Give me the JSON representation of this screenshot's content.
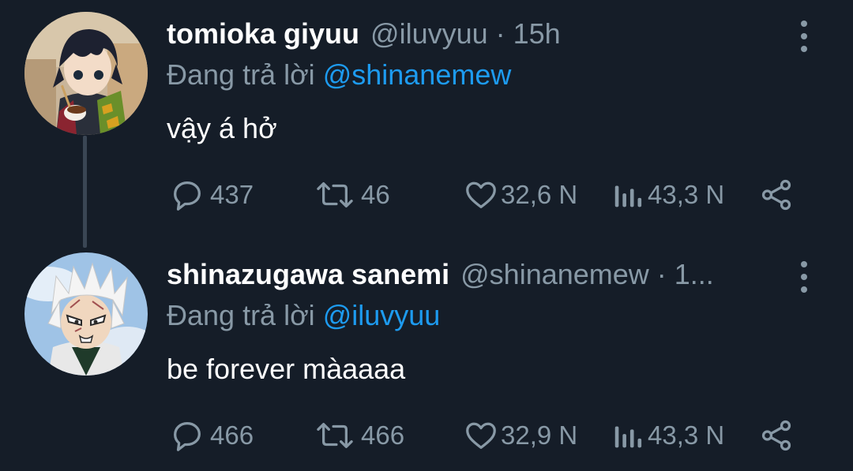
{
  "tweets": [
    {
      "name": "tomioka giyuu",
      "handle_time": "@iluvyuu · 15h",
      "reply_prefix": "Đang trả lời",
      "reply_to": "@shinanemew",
      "text": "vậy á hở",
      "stats": {
        "replies": "437",
        "retweets": "46",
        "likes": "32,6 N",
        "views": "43,3 N"
      },
      "avatar_icon": "avatar-tomioka-giyuu"
    },
    {
      "name": "shinazugawa sanemi",
      "handle_time": "@shinanemew · 1...",
      "reply_prefix": "Đang trả lời",
      "reply_to": "@iluvyuu",
      "text": "be forever màaaaa",
      "stats": {
        "replies": "466",
        "retweets": "466",
        "likes": "32,9 N",
        "views": "43,3 N"
      },
      "avatar_icon": "avatar-shinazugawa-sanemi"
    }
  ],
  "icons": {
    "more": "more-vertical-icon",
    "reply": "reply-bubble-icon",
    "retweet": "retweet-icon",
    "like": "heart-icon",
    "views": "views-bar-icon",
    "share": "share-icon"
  },
  "colors": {
    "background": "#151d28",
    "muted": "#8899a6",
    "mention": "#1d9bf0",
    "thread_line": "#3a4654"
  }
}
